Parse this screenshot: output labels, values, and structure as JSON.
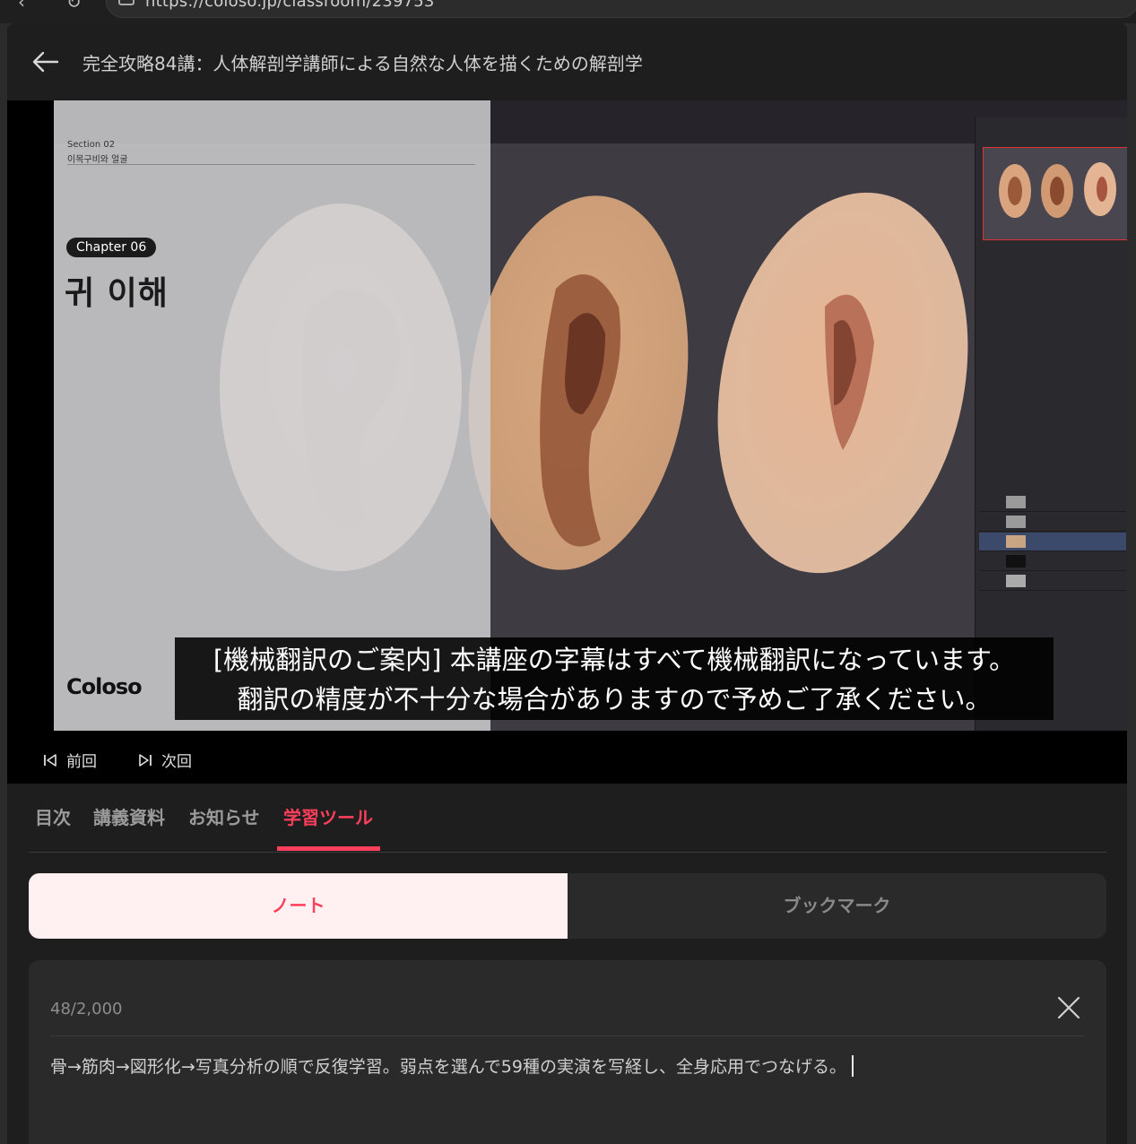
{
  "browser": {
    "url": "https://coloso.jp/classroom/239753"
  },
  "header": {
    "course_title": "完全攻略84講：人体解剖学講師による自然な人体を描くための解剖学"
  },
  "video": {
    "section_label": "Section 02",
    "section_name": "이목구비와 얼굴",
    "chapter_badge": "Chapter 06",
    "chapter_title": "귀 이해",
    "brand_logo": "Coloso",
    "subtitle_line1": "[機械翻訳のご案内] 本講座の字幕はすべて機械翻訳になっています。",
    "subtitle_line2": "翻訳の精度が不十分な場合がありますので予めご了承ください。"
  },
  "controls": {
    "prev_label": "前回",
    "next_label": "次回"
  },
  "tabs": [
    {
      "label": "目次"
    },
    {
      "label": "講義資料"
    },
    {
      "label": "お知らせ"
    },
    {
      "label": "学習ツール",
      "active": true
    }
  ],
  "segments": {
    "note_label": "ノート",
    "bookmark_label": "ブックマーク",
    "active": "ノート"
  },
  "note": {
    "count": "48/2,000",
    "text": "骨→筋肉→図形化→写真分析の順で反復学習。弱点を選んで59種の実演を写経し、全身応用でつなげる。"
  },
  "colors": {
    "accent": "#ff3f5b",
    "note_active_bg": "#fff1f2",
    "page_bg": "#1e1e1e"
  }
}
